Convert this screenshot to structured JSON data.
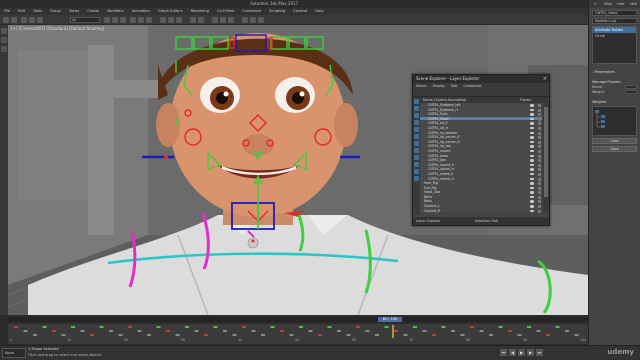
{
  "window": {
    "title": "Autodesk 3ds Max 2017",
    "minimize": "–",
    "maximize": "□",
    "close": "✕"
  },
  "menu": [
    "File",
    "Edit",
    "Tools",
    "Group",
    "Views",
    "Create",
    "Modifiers",
    "Animation",
    "Graph Editors",
    "Rendering",
    "Civil View",
    "Customize",
    "Scripting",
    "Content",
    "Help"
  ],
  "toolbar": {
    "selection_filter": "All"
  },
  "viewport": {
    "label": "[+] [Camera001] [Standard] [Default Shading]"
  },
  "command_panel": {
    "tabs": [
      "+",
      "Mod",
      "Hier",
      "Mot"
    ],
    "object_name": "CNTRL_Head",
    "modifier_list": "Modifier List",
    "stack_items": [
      "Attribute Holder",
      "Circle"
    ],
    "selected_stack_index": 0,
    "section_parameters": "- Parameters",
    "section_manage": "Manage Presets",
    "field_labels": [
      "Name:",
      "Weight:"
    ],
    "section_weights": "Weights",
    "buttons": [
      "Load",
      "Save"
    ]
  },
  "explorer": {
    "title": "Scene Explorer - Layer Explorer",
    "menu": [
      "Select",
      "Display",
      "Edit",
      "Customize"
    ],
    "col_name": "Name (Sorted Ascending)",
    "col_frozen": "Frozen",
    "rows": [
      "CNTRL_Eyebrow_left",
      "CNTRL_Eyebrow_rt",
      "CNTRL_Eyes",
      "CNTRL_Head",
      "CNTRL_lid_lf",
      "CNTRL_lid_rt",
      "CNTRL_lip_bottom",
      "CNTRL_lip_corner_lf",
      "CNTRL_lip_corner_rt",
      "CNTRL_lip_top",
      "CNTRL_mouth",
      "CNTRL_nose",
      "CNTRL_Jaw",
      "CNTRL_squint_lf",
      "CNTRL_squint_rt",
      "CNTRL_cheek_lf",
      "CNTRL_cheek_rt",
      "Face_Rig",
      "Eye_Rig",
      "Head_Geo",
      "Neck",
      "Body",
      "Clavicle_L",
      "Clavicle_R"
    ],
    "highlighted_index": 3,
    "footer_left": "Layer Explorer",
    "footer_right": "Selection Set:"
  },
  "timeline": {
    "slider_label": "82 / 100",
    "ticks": [
      "0",
      "10",
      "20",
      "30",
      "40",
      "50",
      "60",
      "70",
      "80",
      "90",
      "100"
    ]
  },
  "status": {
    "selection_box": "None",
    "line1": "1 Shape Selected",
    "line2": "Click and drag to select and move objects",
    "watermark": "udemy"
  },
  "colors": {
    "controls_cyan": "#27c7c9",
    "controls_green": "#3ecf3e",
    "controls_magenta": "#e02fc8",
    "controls_blue": "#1d1db8",
    "controls_red": "#e32929"
  }
}
